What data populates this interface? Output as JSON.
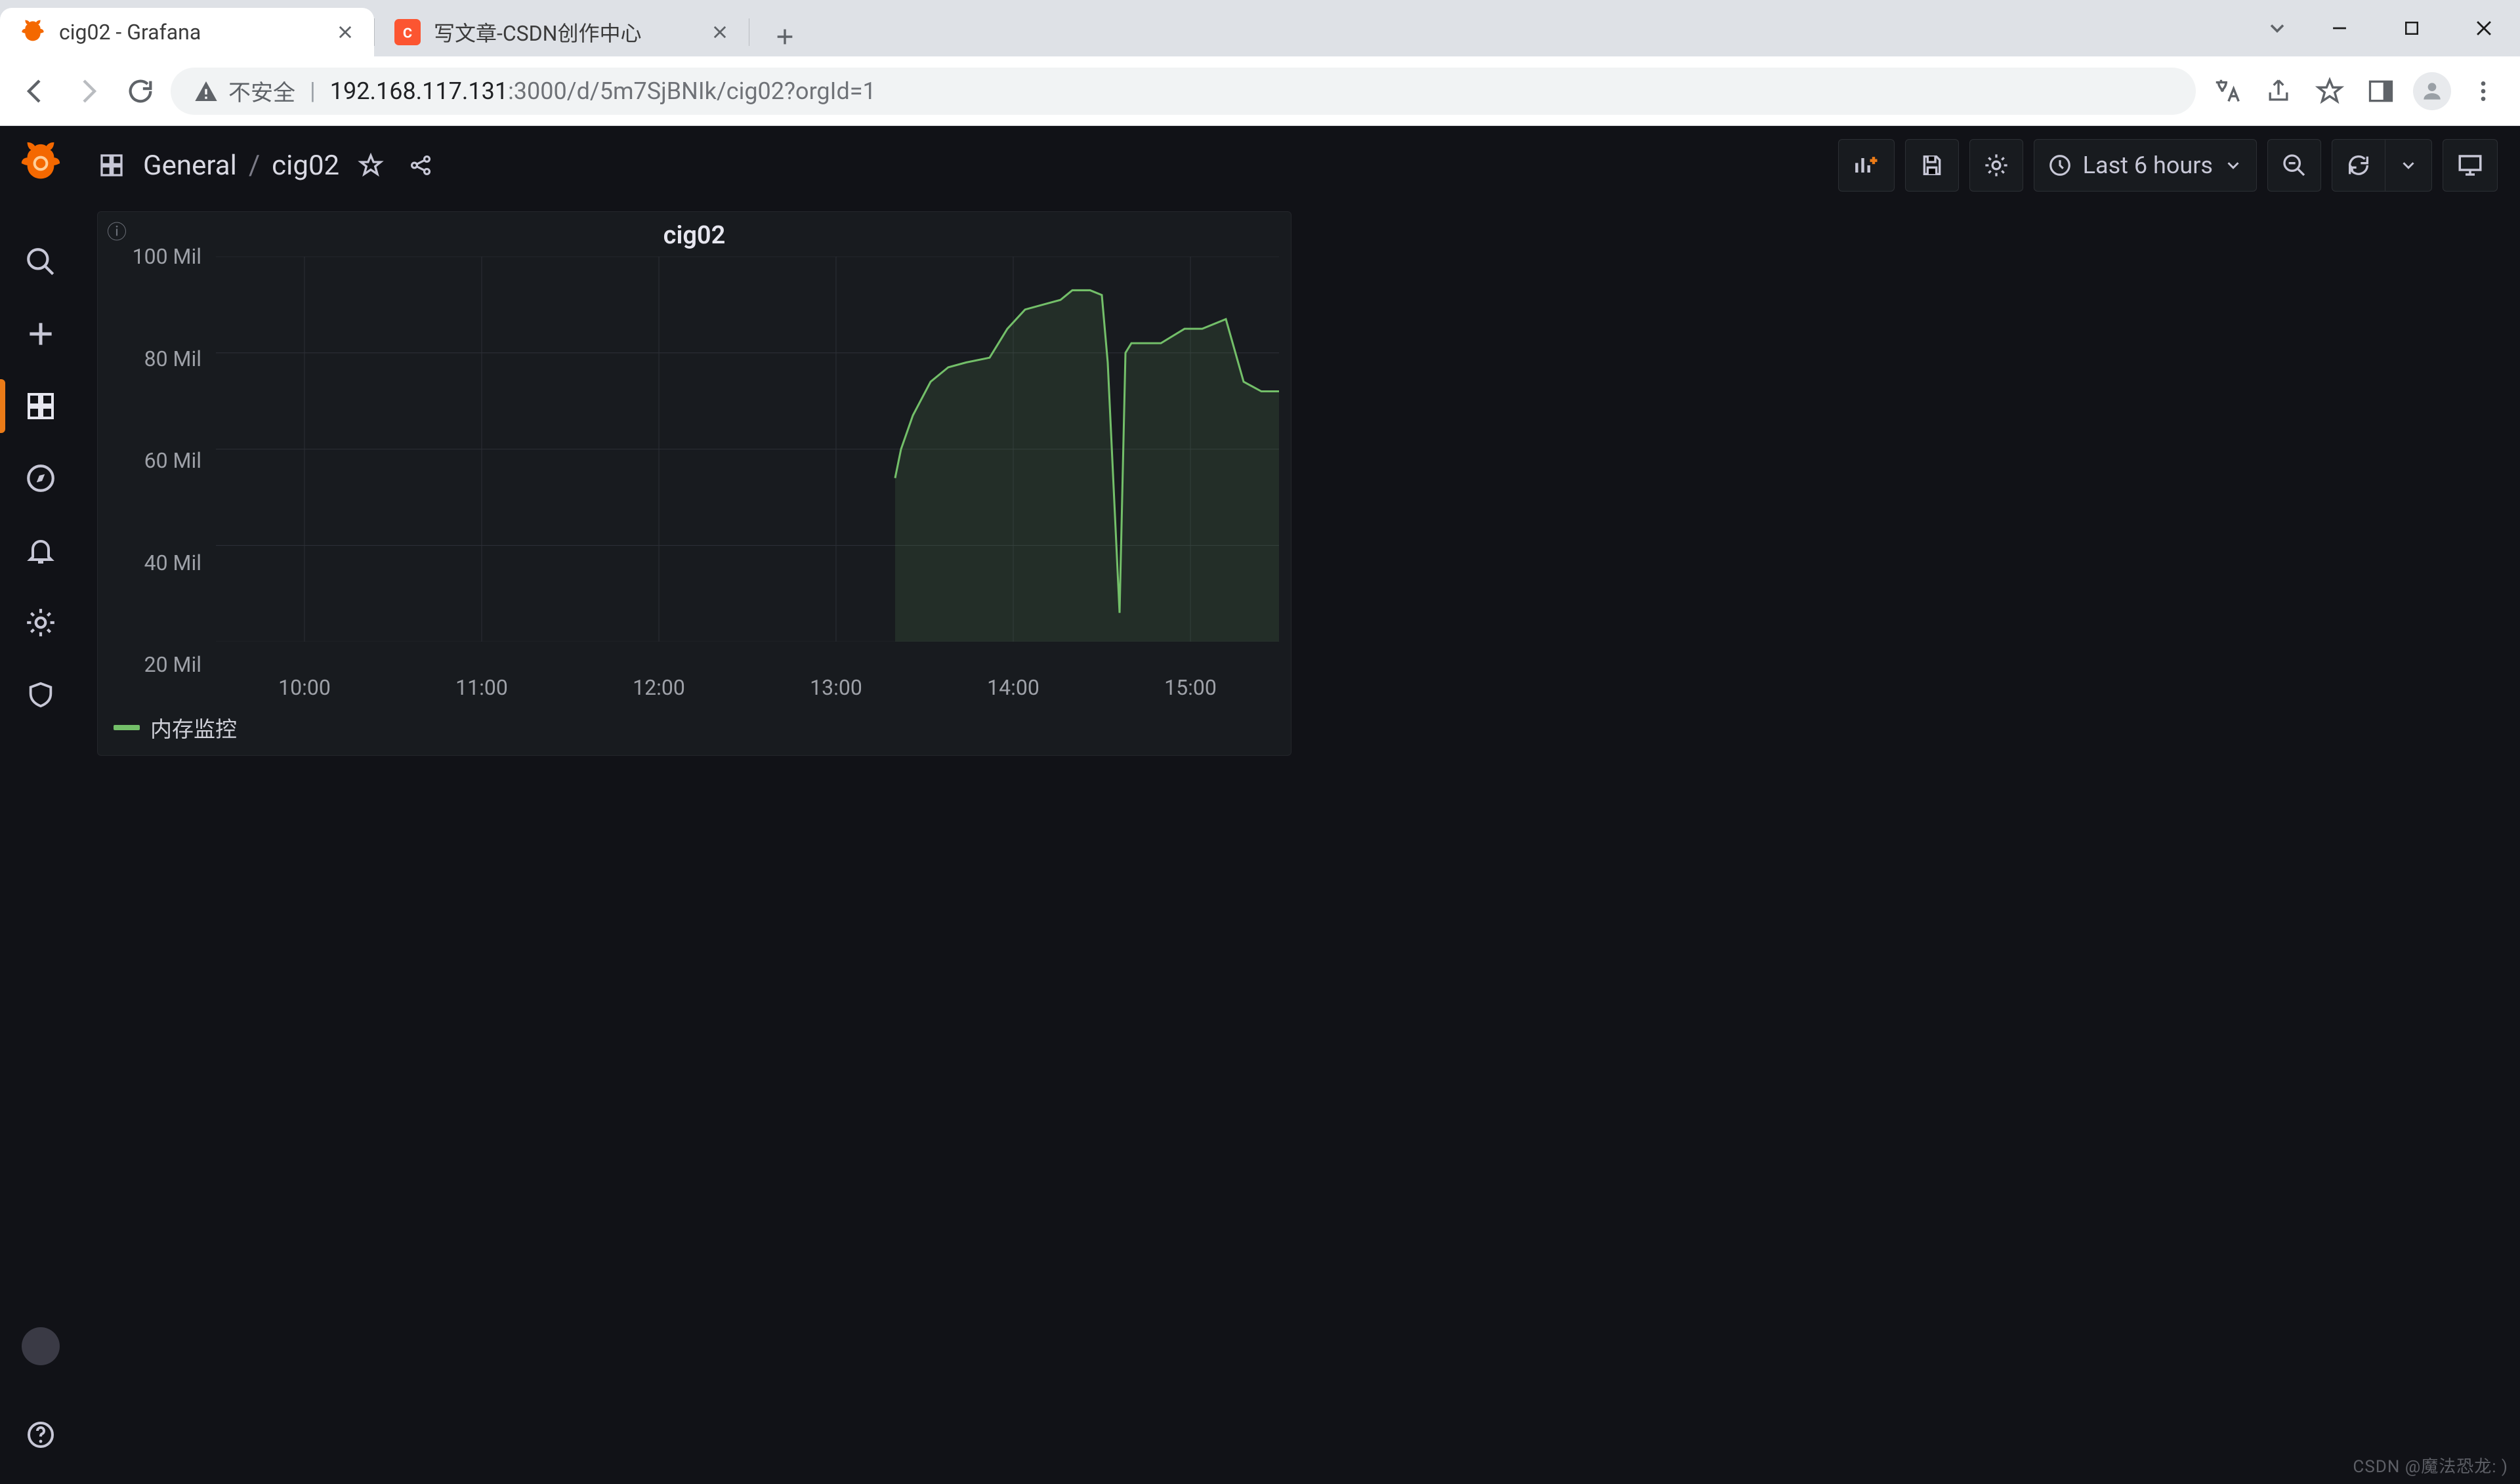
{
  "browser": {
    "tabs": [
      {
        "title": "cig02 - Grafana",
        "active": true
      },
      {
        "title": "写文章-CSDN创作中心",
        "active": false
      }
    ],
    "address": {
      "insecure_label": "不安全",
      "host": "192.168.117.131",
      "rest": ":3000/d/5m7SjBNIk/cig02?orgId=1"
    }
  },
  "grafana": {
    "breadcrumb": {
      "folder": "General",
      "dash": "cig02",
      "sep": "/"
    },
    "time_label": "Last 6 hours"
  },
  "panel": {
    "title": "cig02",
    "legend": "内存监控"
  },
  "watermark": "CSDN @魔法恐龙: )",
  "chart_data": {
    "type": "line",
    "title": "cig02",
    "xlabel": "",
    "ylabel": "",
    "ylim": [
      20,
      100
    ],
    "y_unit": "Mil",
    "y_ticks": [
      20,
      40,
      60,
      80,
      100
    ],
    "x_ticks": [
      "10:00",
      "11:00",
      "12:00",
      "13:00",
      "14:00",
      "15:00"
    ],
    "x_range_minutes": [
      570,
      930
    ],
    "series": [
      {
        "name": "内存监控",
        "color": "#73bf69",
        "x_minutes": [
          800,
          802,
          806,
          812,
          818,
          824,
          832,
          838,
          844,
          850,
          856,
          860,
          866,
          870,
          872,
          876,
          878,
          880,
          884,
          890,
          898,
          904,
          912,
          918,
          924,
          930
        ],
        "values": [
          54,
          60,
          67,
          74,
          77,
          78,
          79,
          85,
          89,
          90,
          91,
          93,
          93,
          92,
          78,
          26,
          80,
          82,
          82,
          82,
          85,
          85,
          87,
          74,
          72,
          72
        ]
      }
    ]
  }
}
